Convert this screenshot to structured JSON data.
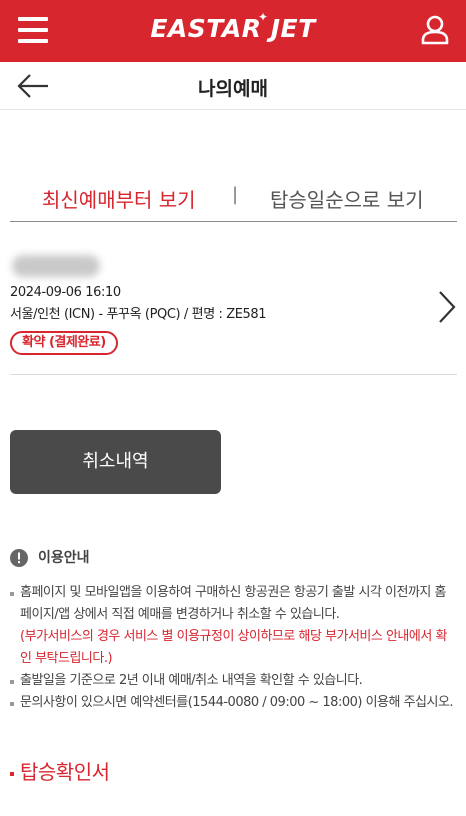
{
  "header": {
    "logo_text": "EASTAR JET",
    "icons": {
      "menu": "hamburger-menu-icon",
      "user": "user-profile-icon"
    },
    "accent_color": "#d8262f"
  },
  "subheader": {
    "title": "나의예매",
    "back_icon": "arrow-left-icon"
  },
  "sort_tabs": {
    "latest": "최신예매부터 보기",
    "separator": "|",
    "boarding": "탑승일순으로 보기",
    "active": "latest"
  },
  "booking": {
    "datetime": "2024-09-06 16:10",
    "route": "서울/인천 (ICN) - 푸꾸옥 (PQC) / 편명 : ZE581",
    "status": "확약 (결제완료)"
  },
  "cancel_history_button": "취소내역",
  "notice": {
    "title": "이용안내",
    "items": [
      {
        "text": "홈페이지 및 모바일앱을 이용하여 구매하신 항공권은 항공기 출발 시각 이전까지 홈페이지/앱 상에서 직접 예매를 변경하거나 취소할 수 있습니다.",
        "note": "(부가서비스의 경우 서비스 별 이용규정이 상이하므로 해당 부가서비스 안내에서 확인 부탁드립니다.)"
      },
      {
        "text": "출발일을 기준으로 2년 이내 예매/취소 내역을 확인할 수 있습니다."
      },
      {
        "text": "문의사항이 있으시면 예약센터를(1544-0080 / 09:00 ~ 18:00) 이용해 주십시오."
      }
    ]
  },
  "boarding_pass_link": "탑승확인서"
}
